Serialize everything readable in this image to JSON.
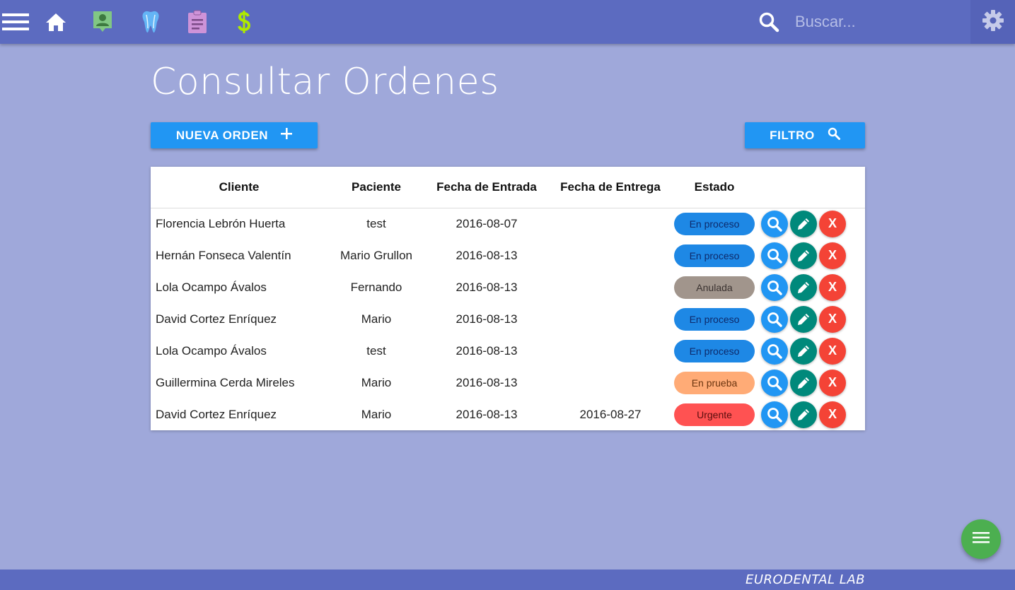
{
  "topbar": {
    "icons": [
      "menu-icon",
      "home-icon",
      "contact-icon",
      "tooth-icon",
      "clipboard-icon",
      "dollar-icon"
    ],
    "search_placeholder": "Buscar...",
    "colors": {
      "bar": "#5c6bc0",
      "contact": "#81c784",
      "tooth": "#64b5f6",
      "clipboard": "#ce93d8",
      "dollar": "#aeea00"
    }
  },
  "page": {
    "title": "Consultar Ordenes"
  },
  "buttons": {
    "new_order": "NUEVA ORDEN",
    "filter": "FILTRO"
  },
  "table": {
    "headers": [
      "Cliente",
      "Paciente",
      "Fecha de Entrada",
      "Fecha de Entrega",
      "Estado"
    ],
    "rows": [
      {
        "cliente": "Florencia Lebrón Huerta",
        "paciente": "test",
        "entrada": "2016-08-07",
        "entrega": "",
        "estado": "En proceso",
        "estado_color": "#1e88e5",
        "estado_text": "#0d2a6b"
      },
      {
        "cliente": "Hernán Fonseca Valentín",
        "paciente": "Mario Grullon",
        "entrada": "2016-08-13",
        "entrega": "",
        "estado": "En proceso",
        "estado_color": "#1e88e5",
        "estado_text": "#0d2a6b"
      },
      {
        "cliente": "Lola Ocampo Ávalos",
        "paciente": "Fernando",
        "entrada": "2016-08-13",
        "entrega": "",
        "estado": "Anulada",
        "estado_color": "#a1958c",
        "estado_text": "#3a3230"
      },
      {
        "cliente": "David Cortez Enríquez",
        "paciente": "Mario",
        "entrada": "2016-08-13",
        "entrega": "",
        "estado": "En proceso",
        "estado_color": "#1e88e5",
        "estado_text": "#0d2a6b"
      },
      {
        "cliente": "Lola Ocampo Ávalos",
        "paciente": "test",
        "entrada": "2016-08-13",
        "entrega": "",
        "estado": "En proceso",
        "estado_color": "#1e88e5",
        "estado_text": "#0d2a6b"
      },
      {
        "cliente": "Guillermina Cerda Mireles",
        "paciente": "Mario",
        "entrada": "2016-08-13",
        "entrega": "",
        "estado": "En prueba",
        "estado_color": "#ffab76",
        "estado_text": "#6b3510"
      },
      {
        "cliente": "David Cortez Enríquez",
        "paciente": "Mario",
        "entrada": "2016-08-13",
        "entrega": "2016-08-27",
        "estado": "Urgente",
        "estado_color": "#ff5252",
        "estado_text": "#5a0e0e"
      }
    ],
    "delete_label": "X"
  },
  "footer": {
    "brand": "EURODENTAL LAB"
  }
}
